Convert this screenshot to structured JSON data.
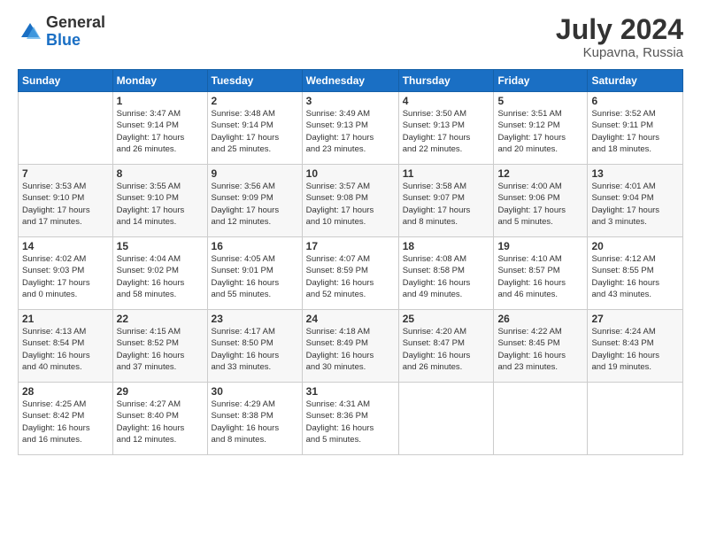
{
  "header": {
    "logo_general": "General",
    "logo_blue": "Blue",
    "month_year": "July 2024",
    "location": "Kupavna, Russia"
  },
  "weekdays": [
    "Sunday",
    "Monday",
    "Tuesday",
    "Wednesday",
    "Thursday",
    "Friday",
    "Saturday"
  ],
  "weeks": [
    [
      {
        "day": "",
        "info": ""
      },
      {
        "day": "1",
        "info": "Sunrise: 3:47 AM\nSunset: 9:14 PM\nDaylight: 17 hours\nand 26 minutes."
      },
      {
        "day": "2",
        "info": "Sunrise: 3:48 AM\nSunset: 9:14 PM\nDaylight: 17 hours\nand 25 minutes."
      },
      {
        "day": "3",
        "info": "Sunrise: 3:49 AM\nSunset: 9:13 PM\nDaylight: 17 hours\nand 23 minutes."
      },
      {
        "day": "4",
        "info": "Sunrise: 3:50 AM\nSunset: 9:13 PM\nDaylight: 17 hours\nand 22 minutes."
      },
      {
        "day": "5",
        "info": "Sunrise: 3:51 AM\nSunset: 9:12 PM\nDaylight: 17 hours\nand 20 minutes."
      },
      {
        "day": "6",
        "info": "Sunrise: 3:52 AM\nSunset: 9:11 PM\nDaylight: 17 hours\nand 18 minutes."
      }
    ],
    [
      {
        "day": "7",
        "info": "Sunrise: 3:53 AM\nSunset: 9:10 PM\nDaylight: 17 hours\nand 17 minutes."
      },
      {
        "day": "8",
        "info": "Sunrise: 3:55 AM\nSunset: 9:10 PM\nDaylight: 17 hours\nand 14 minutes."
      },
      {
        "day": "9",
        "info": "Sunrise: 3:56 AM\nSunset: 9:09 PM\nDaylight: 17 hours\nand 12 minutes."
      },
      {
        "day": "10",
        "info": "Sunrise: 3:57 AM\nSunset: 9:08 PM\nDaylight: 17 hours\nand 10 minutes."
      },
      {
        "day": "11",
        "info": "Sunrise: 3:58 AM\nSunset: 9:07 PM\nDaylight: 17 hours\nand 8 minutes."
      },
      {
        "day": "12",
        "info": "Sunrise: 4:00 AM\nSunset: 9:06 PM\nDaylight: 17 hours\nand 5 minutes."
      },
      {
        "day": "13",
        "info": "Sunrise: 4:01 AM\nSunset: 9:04 PM\nDaylight: 17 hours\nand 3 minutes."
      }
    ],
    [
      {
        "day": "14",
        "info": "Sunrise: 4:02 AM\nSunset: 9:03 PM\nDaylight: 17 hours\nand 0 minutes."
      },
      {
        "day": "15",
        "info": "Sunrise: 4:04 AM\nSunset: 9:02 PM\nDaylight: 16 hours\nand 58 minutes."
      },
      {
        "day": "16",
        "info": "Sunrise: 4:05 AM\nSunset: 9:01 PM\nDaylight: 16 hours\nand 55 minutes."
      },
      {
        "day": "17",
        "info": "Sunrise: 4:07 AM\nSunset: 8:59 PM\nDaylight: 16 hours\nand 52 minutes."
      },
      {
        "day": "18",
        "info": "Sunrise: 4:08 AM\nSunset: 8:58 PM\nDaylight: 16 hours\nand 49 minutes."
      },
      {
        "day": "19",
        "info": "Sunrise: 4:10 AM\nSunset: 8:57 PM\nDaylight: 16 hours\nand 46 minutes."
      },
      {
        "day": "20",
        "info": "Sunrise: 4:12 AM\nSunset: 8:55 PM\nDaylight: 16 hours\nand 43 minutes."
      }
    ],
    [
      {
        "day": "21",
        "info": "Sunrise: 4:13 AM\nSunset: 8:54 PM\nDaylight: 16 hours\nand 40 minutes."
      },
      {
        "day": "22",
        "info": "Sunrise: 4:15 AM\nSunset: 8:52 PM\nDaylight: 16 hours\nand 37 minutes."
      },
      {
        "day": "23",
        "info": "Sunrise: 4:17 AM\nSunset: 8:50 PM\nDaylight: 16 hours\nand 33 minutes."
      },
      {
        "day": "24",
        "info": "Sunrise: 4:18 AM\nSunset: 8:49 PM\nDaylight: 16 hours\nand 30 minutes."
      },
      {
        "day": "25",
        "info": "Sunrise: 4:20 AM\nSunset: 8:47 PM\nDaylight: 16 hours\nand 26 minutes."
      },
      {
        "day": "26",
        "info": "Sunrise: 4:22 AM\nSunset: 8:45 PM\nDaylight: 16 hours\nand 23 minutes."
      },
      {
        "day": "27",
        "info": "Sunrise: 4:24 AM\nSunset: 8:43 PM\nDaylight: 16 hours\nand 19 minutes."
      }
    ],
    [
      {
        "day": "28",
        "info": "Sunrise: 4:25 AM\nSunset: 8:42 PM\nDaylight: 16 hours\nand 16 minutes."
      },
      {
        "day": "29",
        "info": "Sunrise: 4:27 AM\nSunset: 8:40 PM\nDaylight: 16 hours\nand 12 minutes."
      },
      {
        "day": "30",
        "info": "Sunrise: 4:29 AM\nSunset: 8:38 PM\nDaylight: 16 hours\nand 8 minutes."
      },
      {
        "day": "31",
        "info": "Sunrise: 4:31 AM\nSunset: 8:36 PM\nDaylight: 16 hours\nand 5 minutes."
      },
      {
        "day": "",
        "info": ""
      },
      {
        "day": "",
        "info": ""
      },
      {
        "day": "",
        "info": ""
      }
    ]
  ]
}
